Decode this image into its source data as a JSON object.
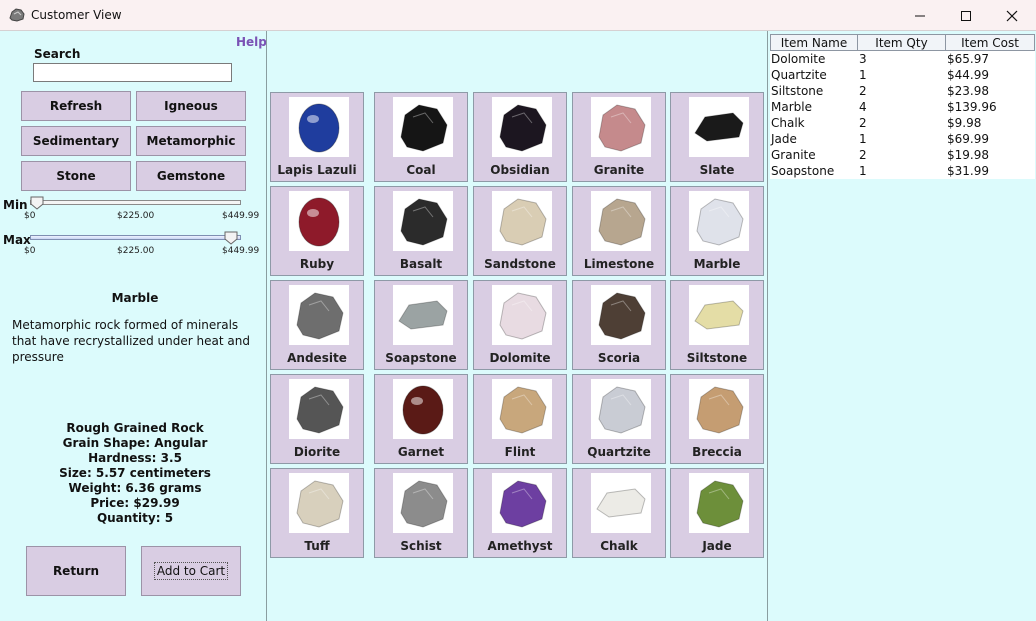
{
  "window": {
    "title": "Customer View",
    "icon": "rock-app-icon"
  },
  "left": {
    "help_label": "Help",
    "search": {
      "label": "Search",
      "value": "",
      "placeholder": ""
    },
    "filter_buttons": [
      {
        "label": "Refresh"
      },
      {
        "label": "Igneous"
      },
      {
        "label": "Sedimentary"
      },
      {
        "label": "Metamorphic"
      },
      {
        "label": "Stone"
      },
      {
        "label": "Gemstone"
      }
    ],
    "min_slider": {
      "label": "Min",
      "ticks": [
        "$0",
        "$225.00",
        "$449.99"
      ],
      "value": 0
    },
    "max_slider": {
      "label": "Max",
      "ticks": [
        "$0",
        "$225.00",
        "$449.99"
      ],
      "value": 449.99
    },
    "detail": {
      "name": "Marble",
      "description": "Metamorphic rock formed of minerals that have recrystallized under heat and pressure",
      "properties": [
        "Rough Grained Rock",
        "Grain Shape: Angular",
        "Hardness: 3.5",
        "Size: 5.57 centimeters",
        "Weight: 6.36 grams",
        "Price: $29.99",
        "Quantity: 5"
      ]
    },
    "return_label": "Return",
    "add_to_cart_label": "Add to Cart"
  },
  "catalog": [
    {
      "name": "Lapis Lazuli",
      "color": "#1f3d9e",
      "shape": "oval"
    },
    {
      "name": "Coal",
      "color": "#151515",
      "shape": "chunk"
    },
    {
      "name": "Obsidian",
      "color": "#1c1620",
      "shape": "chunk"
    },
    {
      "name": "Granite",
      "color": "#c58a8c",
      "shape": "chunk"
    },
    {
      "name": "Slate",
      "color": "#1a1a1a",
      "shape": "flat"
    },
    {
      "name": "Ruby",
      "color": "#8e1a2a",
      "shape": "oval"
    },
    {
      "name": "Basalt",
      "color": "#2b2b2b",
      "shape": "chunk"
    },
    {
      "name": "Sandstone",
      "color": "#d9cdb4",
      "shape": "chunk"
    },
    {
      "name": "Limestone",
      "color": "#b7a68f",
      "shape": "chunk"
    },
    {
      "name": "Marble",
      "color": "#dfe2ea",
      "shape": "chunk"
    },
    {
      "name": "Andesite",
      "color": "#6e6e6e",
      "shape": "chunk"
    },
    {
      "name": "Soapstone",
      "color": "#9ba3a3",
      "shape": "flat"
    },
    {
      "name": "Dolomite",
      "color": "#e8dbe2",
      "shape": "chunk"
    },
    {
      "name": "Scoria",
      "color": "#4e3f35",
      "shape": "chunk"
    },
    {
      "name": "Siltstone",
      "color": "#e4dda6",
      "shape": "flat"
    },
    {
      "name": "Diorite",
      "color": "#555555",
      "shape": "chunk"
    },
    {
      "name": "Garnet",
      "color": "#5a1a16",
      "shape": "oval"
    },
    {
      "name": "Flint",
      "color": "#c8a77c",
      "shape": "chunk"
    },
    {
      "name": "Quartzite",
      "color": "#c9ccd4",
      "shape": "chunk"
    },
    {
      "name": "Breccia",
      "color": "#c59d72",
      "shape": "chunk"
    },
    {
      "name": "Tuff",
      "color": "#d8d0bd",
      "shape": "chunk"
    },
    {
      "name": "Schist",
      "color": "#8c8c8c",
      "shape": "chunk"
    },
    {
      "name": "Amethyst",
      "color": "#6d3fa1",
      "shape": "chunk"
    },
    {
      "name": "Chalk",
      "color": "#ecebe6",
      "shape": "flat"
    },
    {
      "name": "Jade",
      "color": "#6d8f3a",
      "shape": "chunk"
    }
  ],
  "cart": {
    "headers": [
      "Item Name",
      "Item Qty",
      "Item Cost"
    ],
    "rows": [
      [
        "Dolomite",
        "3",
        "$65.97"
      ],
      [
        "Quartzite",
        "1",
        "$44.99"
      ],
      [
        "Siltstone",
        "2",
        "$23.98"
      ],
      [
        "Marble",
        "4",
        "$139.96"
      ],
      [
        "Chalk",
        "2",
        "$9.98"
      ],
      [
        "Jade",
        "1",
        "$69.99"
      ],
      [
        "Granite",
        "2",
        "$19.98"
      ],
      [
        "Soapstone",
        "1",
        "$31.99"
      ]
    ]
  }
}
